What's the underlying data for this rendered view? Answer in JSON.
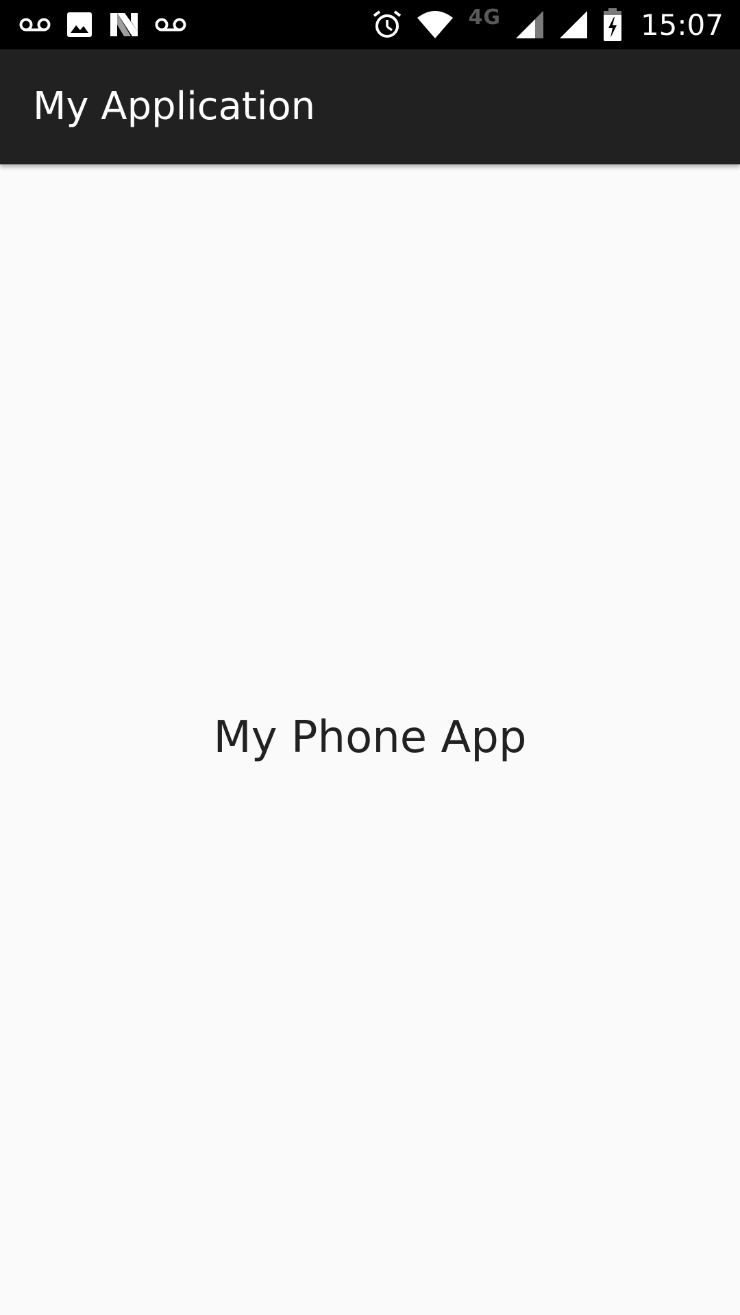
{
  "status_bar": {
    "left_icons": [
      "voicemail-icon",
      "image-icon",
      "n-notification-icon",
      "voicemail-icon"
    ],
    "right_icons": [
      "alarm-icon",
      "wifi-icon",
      "cell-signal-icon",
      "cell-signal-icon",
      "battery-charging-icon"
    ],
    "network_label": "4G",
    "time": "15:07"
  },
  "app_bar": {
    "title": "My Application",
    "background": "#212121"
  },
  "content": {
    "text": "My Phone App",
    "background": "#fafafa"
  }
}
